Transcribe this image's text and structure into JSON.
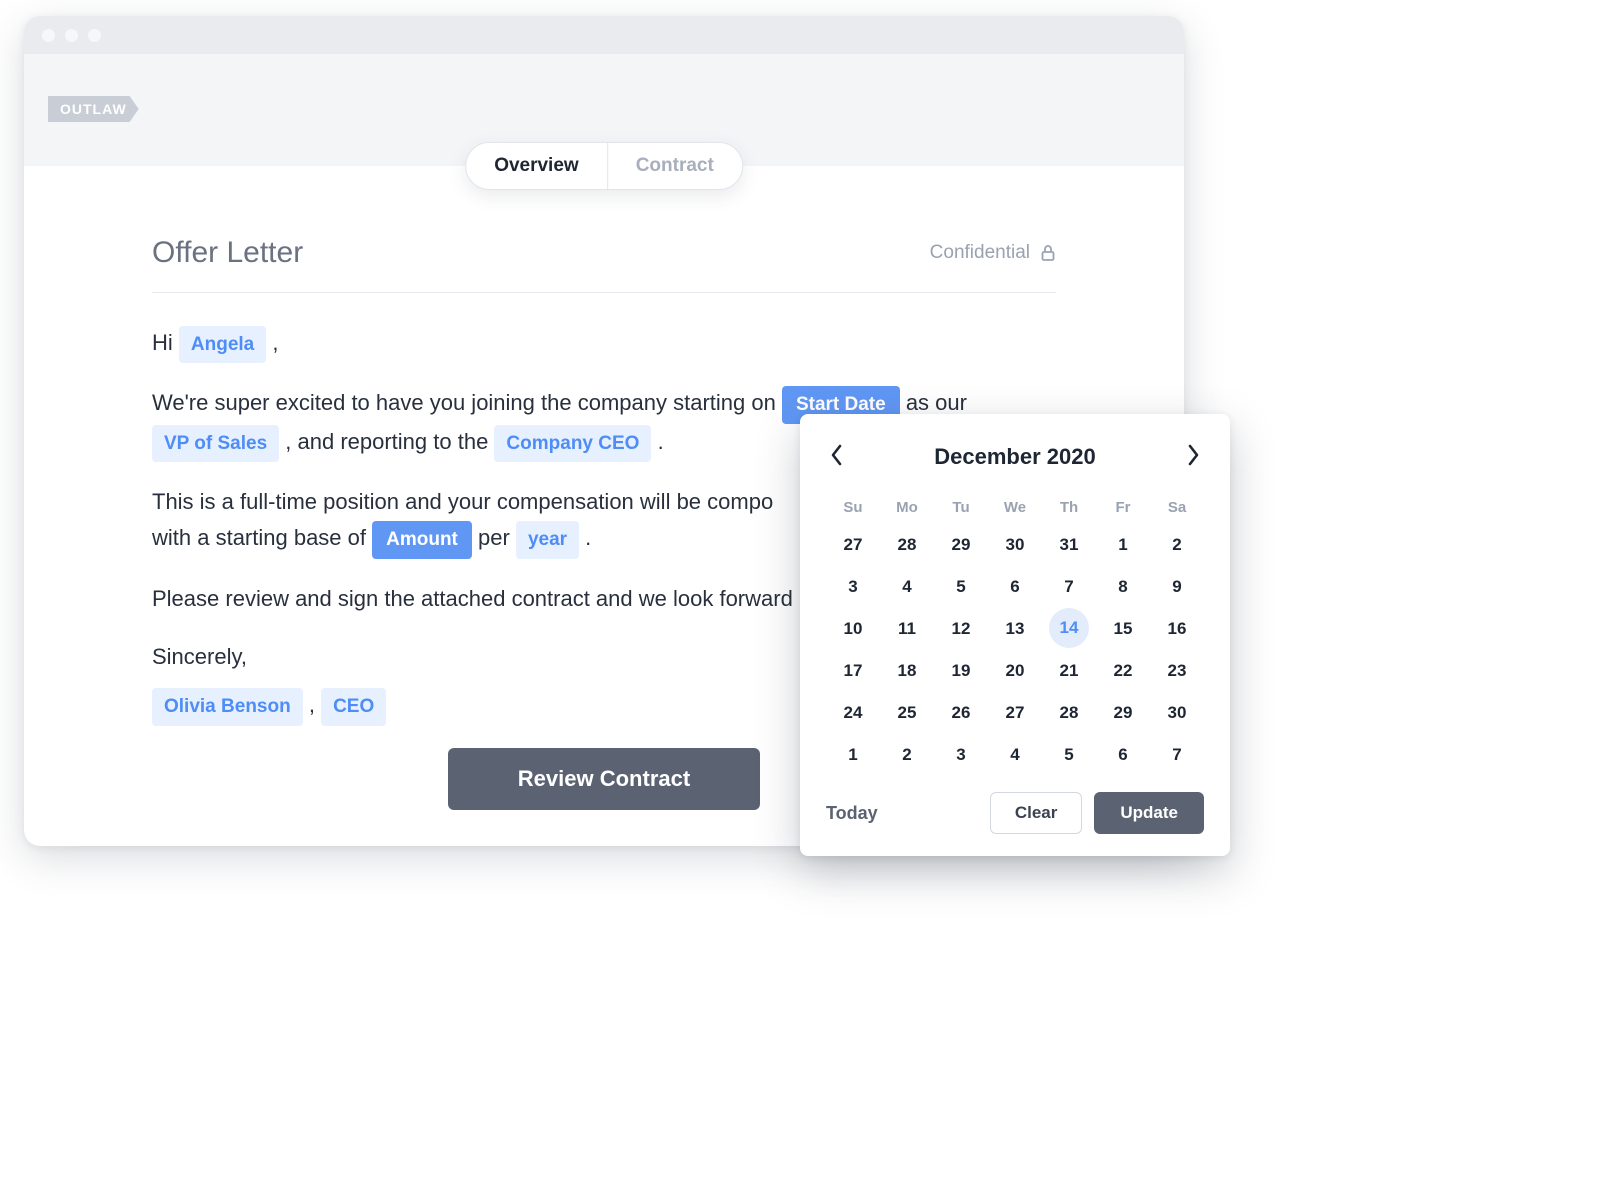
{
  "brand": "OUTLAW",
  "tabs": {
    "overview": "Overview",
    "contract": "Contract",
    "active": "overview"
  },
  "header": {
    "title": "Offer Letter",
    "confidential": "Confidential"
  },
  "letter": {
    "greeting_prefix": "Hi ",
    "name_pill": "Angela",
    "greeting_suffix": " ,",
    "p1_a": "We're super excited to have you joining the company starting on ",
    "start_date_pill": "Start Date",
    "p1_b": " as our ",
    "role_pill": "VP of Sales",
    "p1_c": " , and reporting to the ",
    "reports_to_pill": "Company CEO",
    "p1_d": " .",
    "p2_a": "This is a full-time position and your compensation will be compo",
    "p2_b": "with a starting base of ",
    "amount_pill": "Amount",
    "p2_c": " per ",
    "period_pill": "year",
    "p2_d": " .",
    "p3": "Please review and sign the attached contract and we look forward",
    "closing": "Sincerely,",
    "sender_pill": "Olivia Benson",
    "sender_sep": " , ",
    "sender_title_pill": "CEO"
  },
  "cta": "Review Contract",
  "picker": {
    "title": "December 2020",
    "dow": [
      "Su",
      "Mo",
      "Tu",
      "We",
      "Th",
      "Fr",
      "Sa"
    ],
    "weeks": [
      [
        27,
        28,
        29,
        30,
        31,
        1,
        2
      ],
      [
        3,
        4,
        5,
        6,
        7,
        8,
        9
      ],
      [
        10,
        11,
        12,
        13,
        14,
        15,
        16
      ],
      [
        17,
        18,
        19,
        20,
        21,
        22,
        23
      ],
      [
        24,
        25,
        26,
        27,
        28,
        29,
        30
      ],
      [
        1,
        2,
        3,
        4,
        5,
        6,
        7
      ]
    ],
    "selected": 14,
    "today": "Today",
    "clear": "Clear",
    "update": "Update"
  }
}
